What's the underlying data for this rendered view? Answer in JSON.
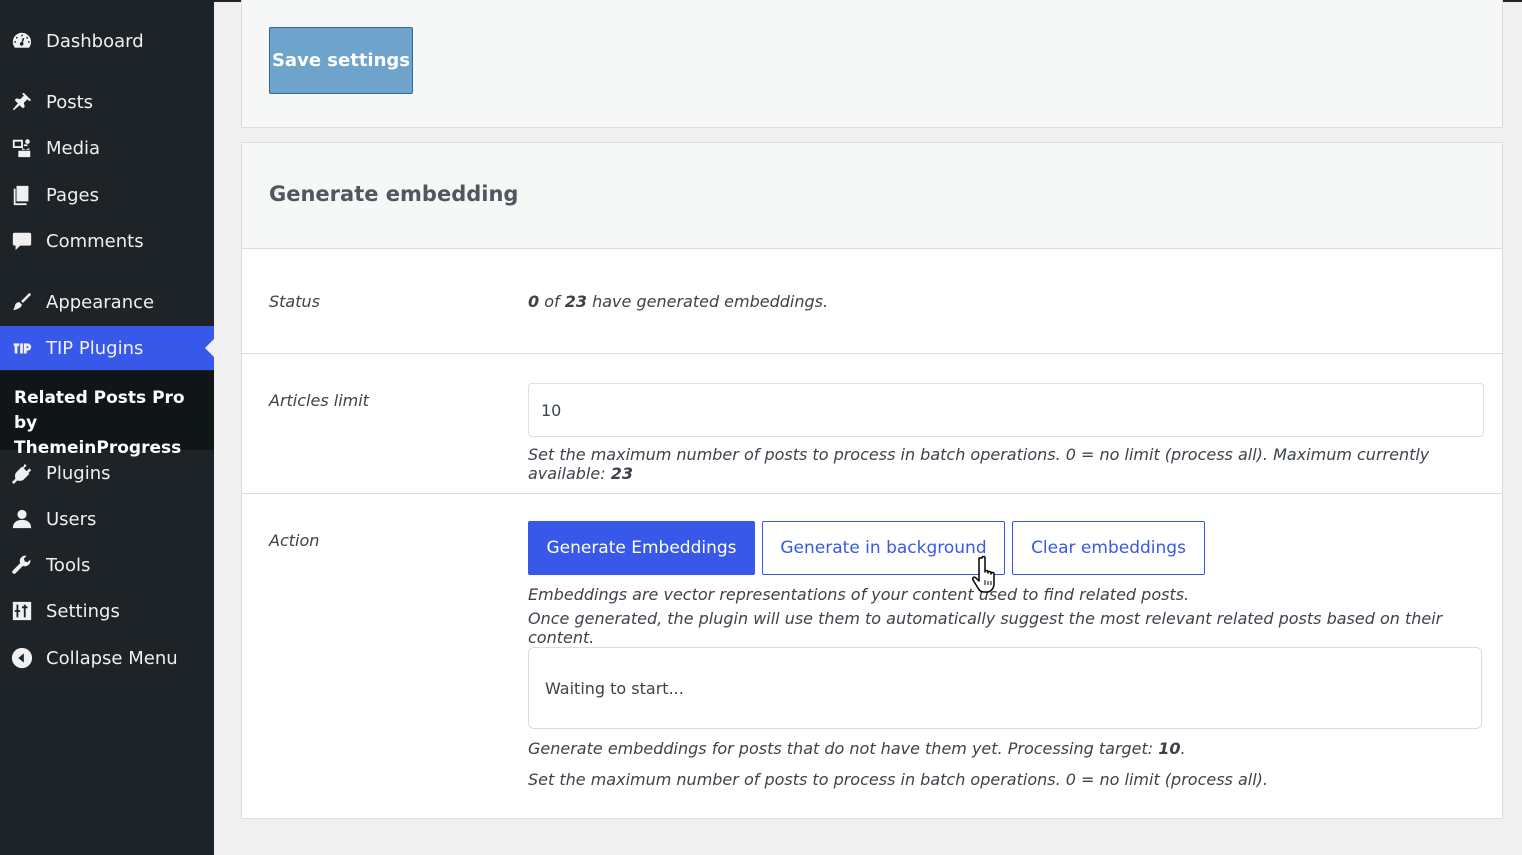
{
  "sidebar": {
    "items": [
      {
        "label": "Dashboard",
        "icon": "dashboard-icon"
      },
      {
        "label": "Posts",
        "icon": "pin-icon"
      },
      {
        "label": "Media",
        "icon": "media-icon"
      },
      {
        "label": "Pages",
        "icon": "pages-icon"
      },
      {
        "label": "Comments",
        "icon": "comment-icon"
      },
      {
        "label": "Appearance",
        "icon": "brush-icon"
      },
      {
        "label": "TIP Plugins",
        "icon": "tip-logo-icon"
      },
      {
        "label": "Plugins",
        "icon": "plug-icon"
      },
      {
        "label": "Users",
        "icon": "user-icon"
      },
      {
        "label": "Tools",
        "icon": "wrench-icon"
      },
      {
        "label": "Settings",
        "icon": "sliders-icon"
      },
      {
        "label": "Collapse Menu",
        "icon": "collapse-icon"
      }
    ],
    "submenu_label": "Related Posts Pro by ThemeinProgress",
    "active_color": "#3858e9"
  },
  "save_section": {
    "save_label": "Save settings"
  },
  "generate": {
    "title": "Generate embedding",
    "status": {
      "label": "Status",
      "done_count": "0",
      "of_text": "of",
      "total_count": "23",
      "suffix": "have generated embeddings."
    },
    "limit": {
      "label": "Articles limit",
      "value": "10",
      "help": "Set the maximum number of posts to process in batch operations. 0 = no limit (process all). Maximum currently available:",
      "max_available": "23"
    },
    "action": {
      "label": "Action",
      "generate_label": "Generate Embeddings",
      "background_label": "Generate in background",
      "clear_label": "Clear embeddings",
      "desc_line1": "Embeddings are vector representations of your content used to find related posts.",
      "desc_line2": "Once generated, the plugin will use them to automatically suggest the most relevant related posts based on their content.",
      "progress_text": "Waiting to start...",
      "target_prefix": "Generate embeddings for posts that do not have them yet. Processing target:",
      "target_value": "10",
      "target_suffix": ".",
      "limit_note": "Set the maximum number of posts to process in batch operations. 0 = no limit (process all)."
    }
  }
}
